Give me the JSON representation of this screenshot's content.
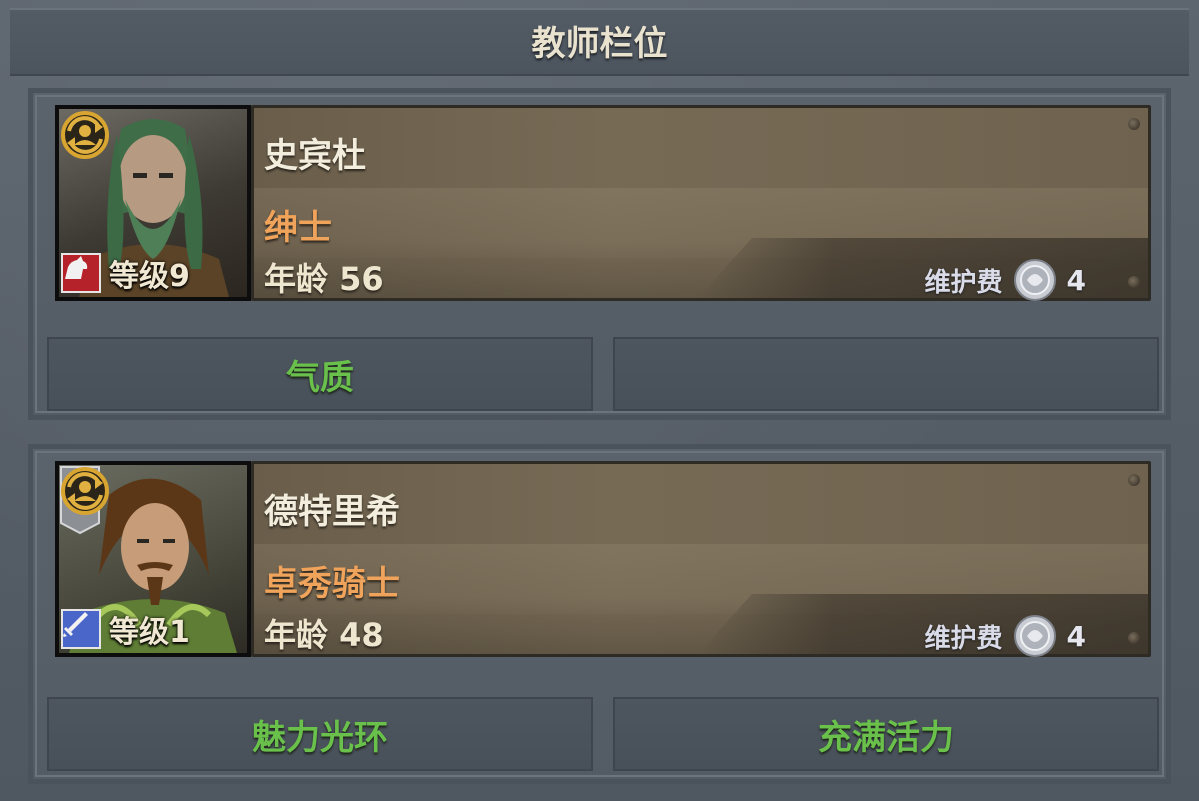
{
  "header": {
    "title": "教师栏位"
  },
  "teachers": [
    {
      "name": "史宾杜",
      "role": "绅士",
      "age_text": "年龄 56",
      "level_text": "等级9",
      "class_icon": "horse-icon",
      "class_color": "#c0262b",
      "upkeep_label": "维护费",
      "upkeep_value": "4",
      "traits": [
        "气质",
        ""
      ]
    },
    {
      "name": "德特里希",
      "role": "卓秀骑士",
      "age_text": "年龄 48",
      "level_text": "等级1",
      "class_icon": "sword-icon",
      "class_color": "#4a66c8",
      "upkeep_label": "维护费",
      "upkeep_value": "4",
      "traits": [
        "魅力光环",
        "充满活力"
      ]
    }
  ],
  "colors": {
    "name": "#f3eddd",
    "role": "#f0a35a",
    "trait": "#69c04b",
    "background": "#58606a"
  }
}
